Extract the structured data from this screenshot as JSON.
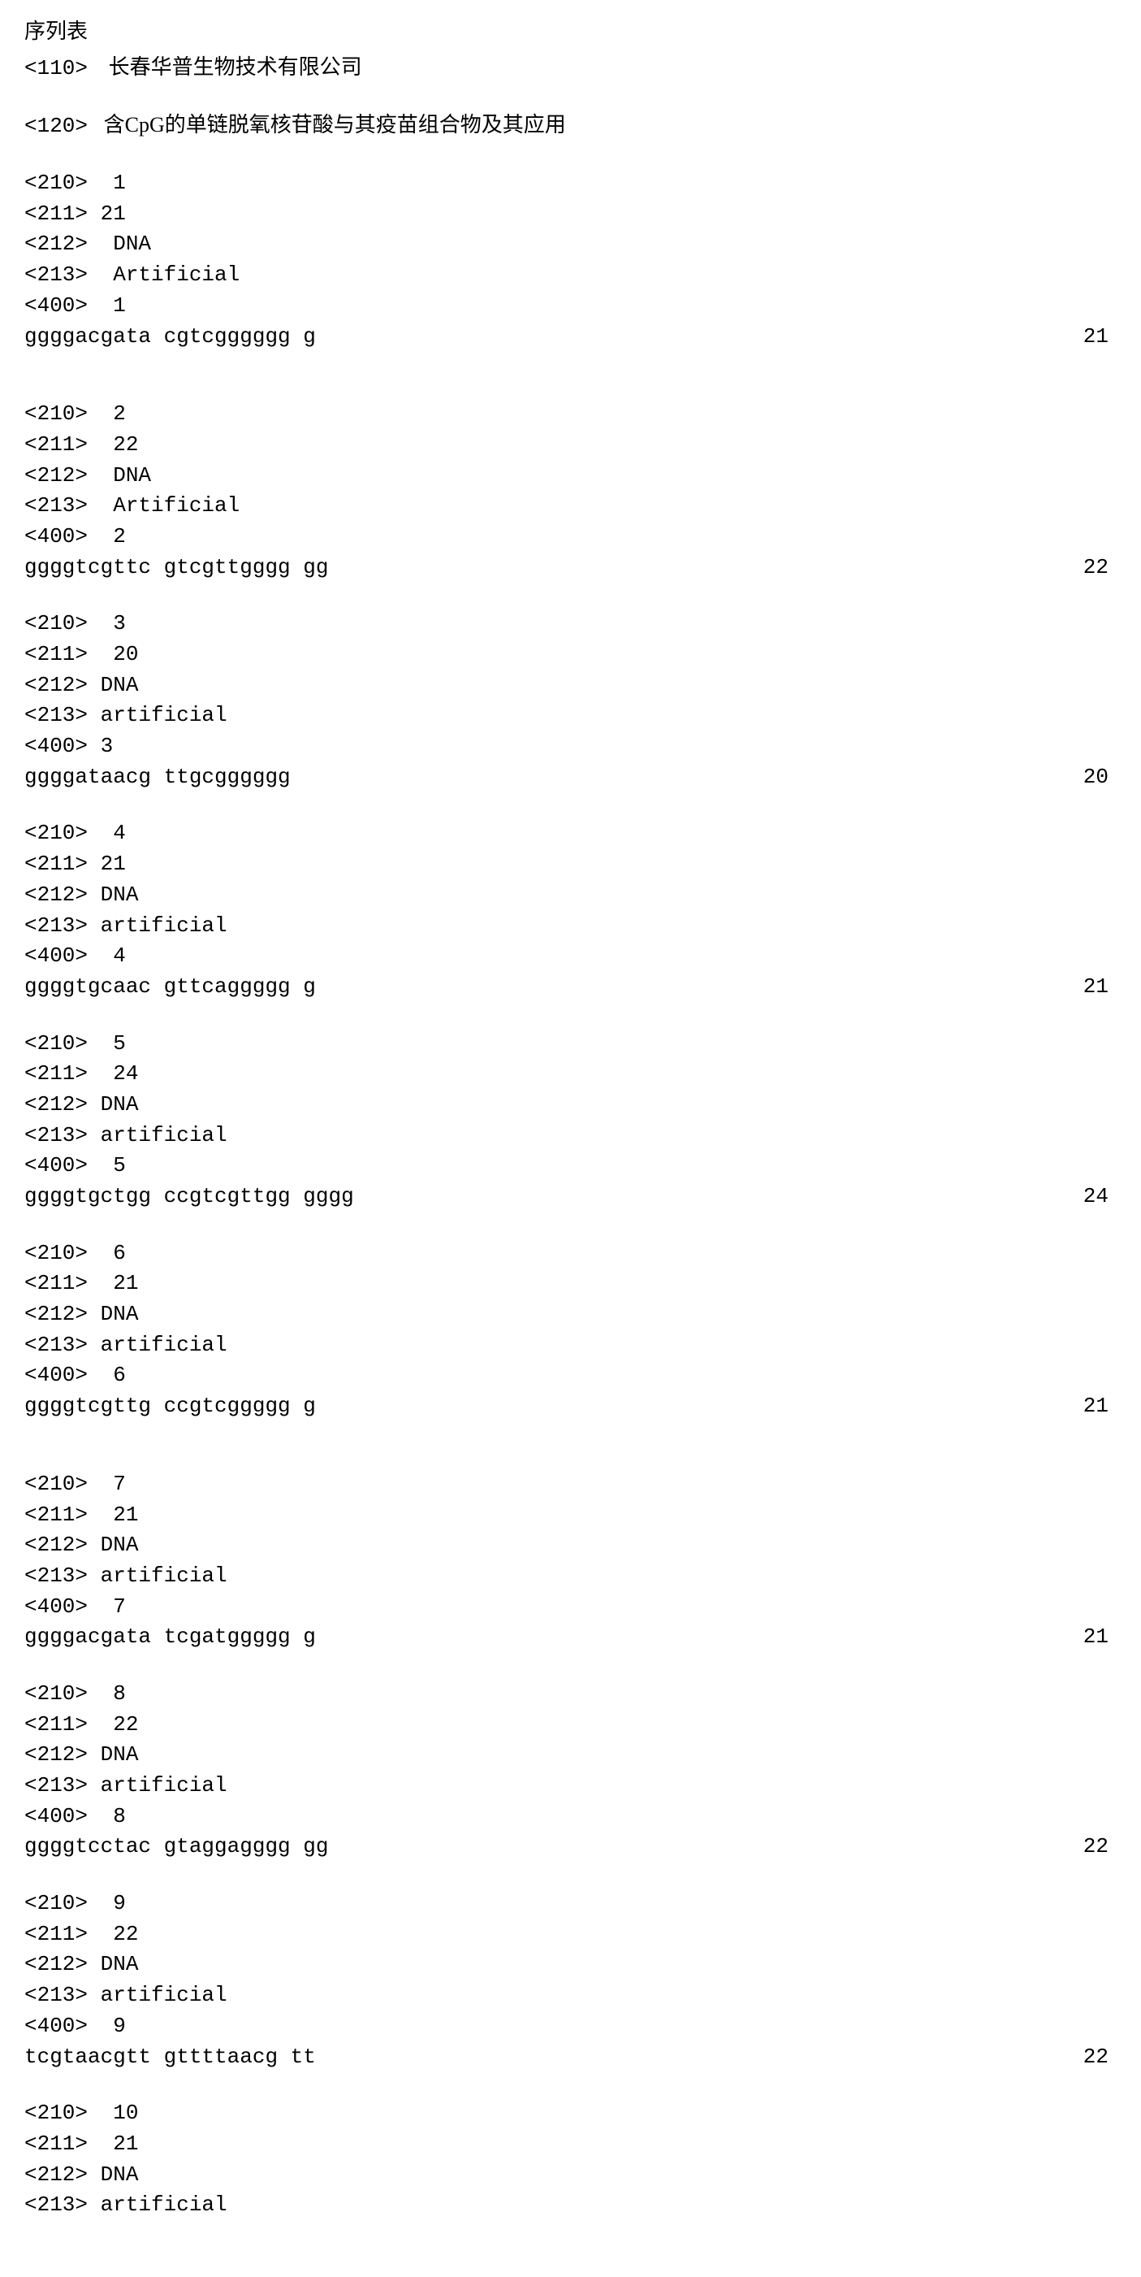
{
  "header": {
    "title": "序列表",
    "applicant_tag": "<110>",
    "applicant": "长春华普生物技术有限公司",
    "title_tag": "<120>",
    "invention_title": "含CpG的单链脱氧核苷酸与其疫苗组合物及其应用"
  },
  "sequences": [
    {
      "t210": "<210>  1",
      "t211": "<211> 21",
      "t212": "<212>  DNA",
      "t213": "<213>  Artificial",
      "t400": "<400>  1",
      "seq": "ggggacgata cgtcgggggg g",
      "len": "21"
    },
    {
      "t210": "<210>  2",
      "t211": "<211>  22",
      "t212": "<212>  DNA",
      "t213": "<213>  Artificial",
      "t400": "<400>  2",
      "seq": "ggggtcgttc gtcgttgggg gg",
      "len": "22"
    },
    {
      "t210": "<210>  3",
      "t211": "<211>  20",
      "t212": "<212> DNA",
      "t213": "<213> artificial",
      "t400": "<400> 3",
      "seq": "ggggataacg ttgcgggggg",
      "len": "20"
    },
    {
      "t210": "<210>  4",
      "t211": "<211> 21",
      "t212": "<212> DNA",
      "t213": "<213> artificial",
      "t400": "<400>  4",
      "seq": "ggggtgcaac gttcaggggg g",
      "len": "21"
    },
    {
      "t210": "<210>  5",
      "t211": "<211>  24",
      "t212": "<212> DNA",
      "t213": "<213> artificial",
      "t400": "<400>  5",
      "seq": "ggggtgctgg ccgtcgttgg gggg",
      "len": "24"
    },
    {
      "t210": "<210>  6",
      "t211": "<211>  21",
      "t212": "<212> DNA",
      "t213": "<213> artificial",
      "t400": "<400>  6",
      "seq": "ggggtcgttg ccgtcggggg g",
      "len": "21"
    },
    {
      "t210": "<210>  7",
      "t211": "<211>  21",
      "t212": "<212> DNA",
      "t213": "<213> artificial",
      "t400": "<400>  7",
      "seq": "ggggacgata tcgatggggg g",
      "len": "21"
    },
    {
      "t210": "<210>  8",
      "t211": "<211>  22",
      "t212": "<212> DNA",
      "t213": "<213> artificial",
      "t400": "<400>  8",
      "seq": "ggggtcctac gtaggagggg gg",
      "len": "22"
    },
    {
      "t210": "<210>  9",
      "t211": "<211>  22",
      "t212": "<212> DNA",
      "t213": "<213> artificial",
      "t400": "<400>  9",
      "seq": "tcgtaacgtt gttttaacg tt",
      "len": "22"
    },
    {
      "t210": "<210>  10",
      "t211": "<211>  21",
      "t212": "<212> DNA",
      "t213": "<213> artificial",
      "t400": "",
      "seq": "",
      "len": ""
    }
  ]
}
